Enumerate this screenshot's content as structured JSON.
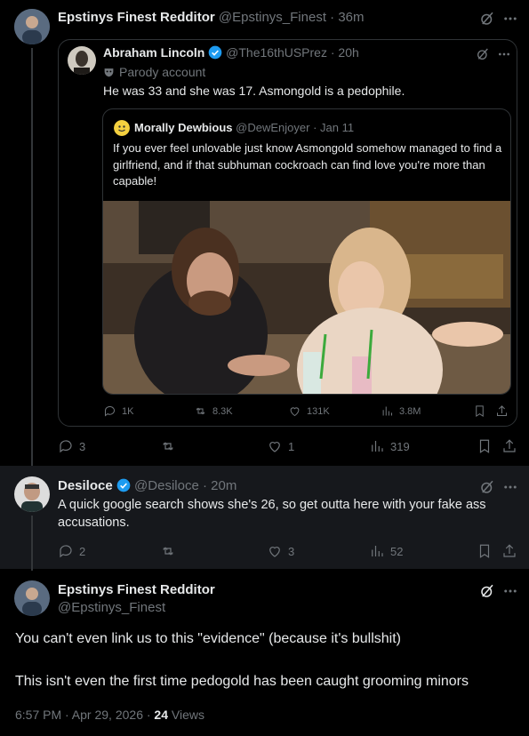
{
  "tweet1": {
    "author_name": "Epstinys Finest Redditor",
    "author_handle": "@Epstinys_Finest",
    "time": "· 36m",
    "quote": {
      "author_name": "Abraham Lincoln",
      "author_handle": "@The16thUSPrez",
      "time": "· 20h",
      "parody_label": "Parody account",
      "text": "He was 33 and she was 17. Asmongold is a pedophile.",
      "inner_quote": {
        "author_name": "Morally Dewbious",
        "author_handle": "@DewEnjoyer",
        "time": "· Jan 11",
        "text": "If you ever feel unlovable just know Asmongold somehow managed to find a girlfriend, and if that subhuman cockroach can find love you're more than capable!",
        "stats": {
          "replies": "1K",
          "reposts": "8.3K",
          "likes": "131K",
          "views": "3.8M"
        }
      }
    },
    "stats": {
      "replies": "3",
      "reposts": "",
      "likes": "1",
      "views": "319"
    }
  },
  "tweet2": {
    "author_name": "Desiloce",
    "author_handle": "@Desiloce",
    "time": "· 20m",
    "text": "A quick google search shows she's 26, so get outta here with your fake ass accusations.",
    "stats": {
      "replies": "2",
      "reposts": "",
      "likes": "3",
      "views": "52"
    }
  },
  "main_tweet": {
    "author_name": "Epstinys Finest Redditor",
    "author_handle": "@Epstinys_Finest",
    "paragraph1": "You can't even link us to this \"evidence\" (because it's bullshit)",
    "paragraph2": "This isn't even the first time pedogold has been caught grooming minors",
    "timestamp": "6:57 PM · Apr 29, 2026 ·",
    "views_count": "24",
    "views_label": "Views"
  },
  "colors": {
    "background": "#000000",
    "card_border": "#2f3336",
    "muted": "#71767b",
    "accent": "#1d9bf0",
    "text": "#e7e9ea"
  }
}
